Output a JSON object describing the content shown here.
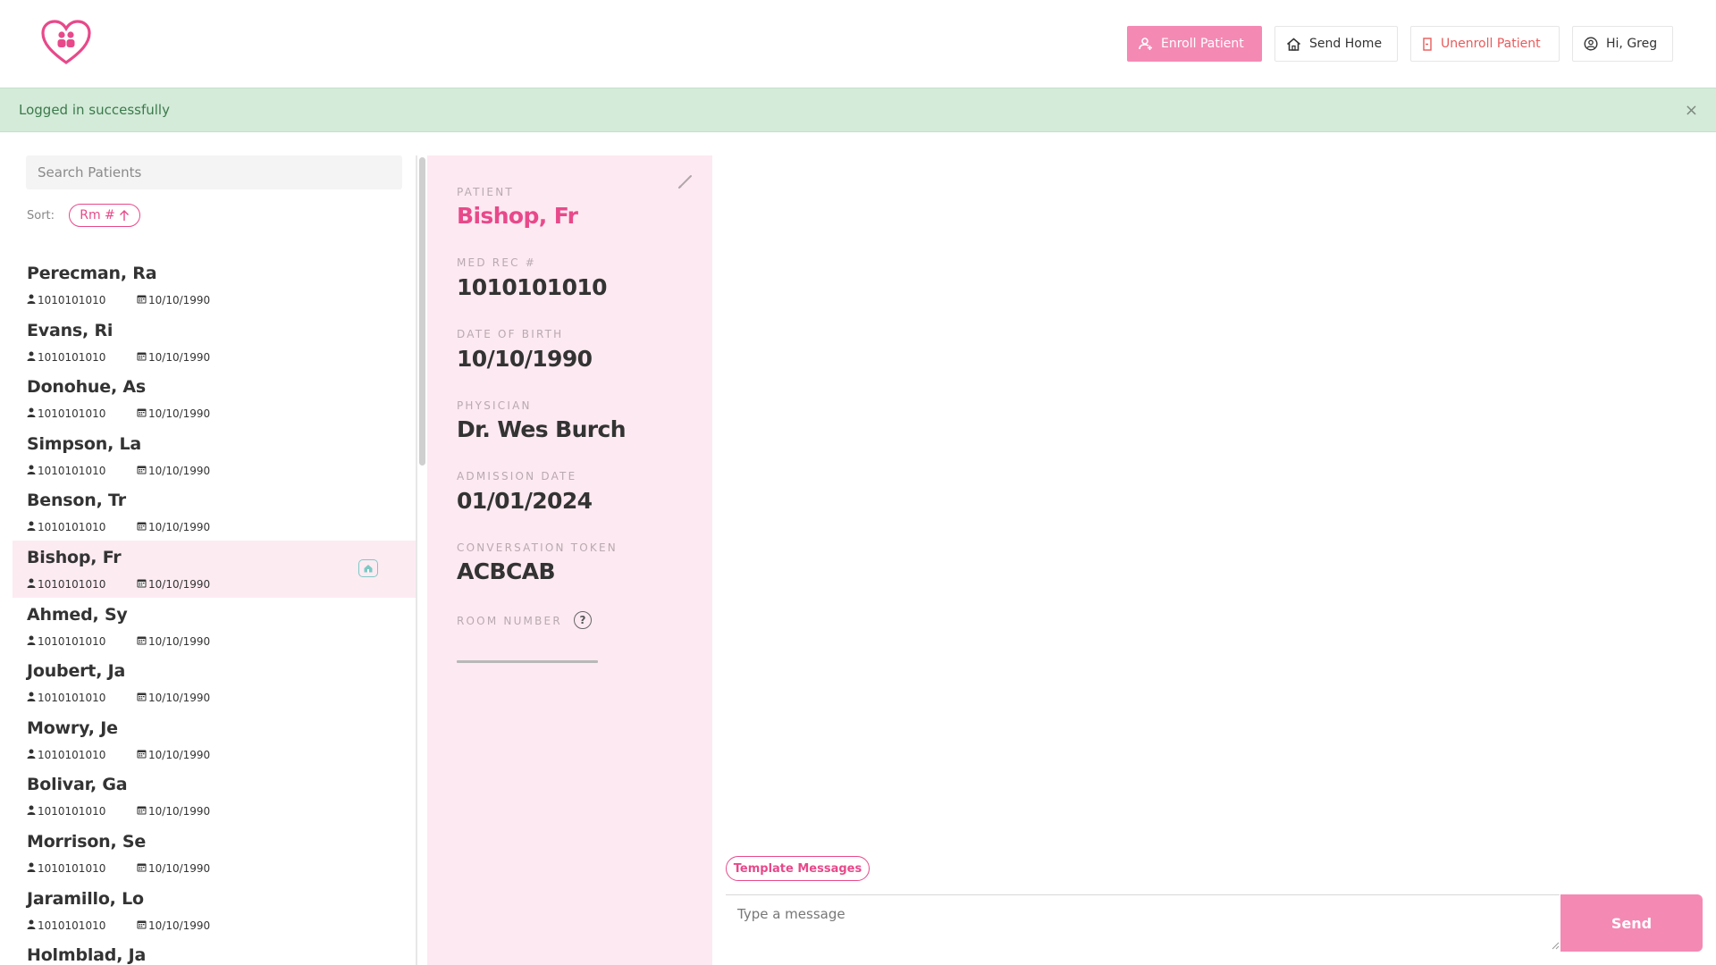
{
  "header": {
    "logo_icon": "heart-people-logo-icon",
    "enroll_label": "Enroll Patient",
    "send_home_label": "Send Home",
    "unenroll_label": "Unenroll Patient",
    "user_label": "Hi, Greg"
  },
  "alert": {
    "message": "Logged in successfully",
    "close": "×"
  },
  "sidebar": {
    "search_placeholder": "Search Patients",
    "sort_label": "Sort:",
    "sort_value": "Rm #",
    "patients": [
      {
        "name": "Perecman, Ra",
        "mrn": "1010101010",
        "dob": "10/10/1990",
        "selected": false
      },
      {
        "name": "Evans, Ri",
        "mrn": "1010101010",
        "dob": "10/10/1990",
        "selected": false
      },
      {
        "name": "Donohue, As",
        "mrn": "1010101010",
        "dob": "10/10/1990",
        "selected": false
      },
      {
        "name": "Simpson, La",
        "mrn": "1010101010",
        "dob": "10/10/1990",
        "selected": false
      },
      {
        "name": "Benson, Tr",
        "mrn": "1010101010",
        "dob": "10/10/1990",
        "selected": false
      },
      {
        "name": "Bishop, Fr",
        "mrn": "1010101010",
        "dob": "10/10/1990",
        "selected": true
      },
      {
        "name": "Ahmed, Sy",
        "mrn": "1010101010",
        "dob": "10/10/1990",
        "selected": false
      },
      {
        "name": "Joubert, Ja",
        "mrn": "1010101010",
        "dob": "10/10/1990",
        "selected": false
      },
      {
        "name": "Mowry, Je",
        "mrn": "1010101010",
        "dob": "10/10/1990",
        "selected": false
      },
      {
        "name": "Bolivar, Ga",
        "mrn": "1010101010",
        "dob": "10/10/1990",
        "selected": false
      },
      {
        "name": "Morrison, Se",
        "mrn": "1010101010",
        "dob": "10/10/1990",
        "selected": false
      },
      {
        "name": "Jaramillo, Lo",
        "mrn": "1010101010",
        "dob": "10/10/1990",
        "selected": false
      },
      {
        "name": "Holmblad, Ja",
        "mrn": "",
        "dob": "",
        "selected": false
      }
    ]
  },
  "detail": {
    "patient_label": "PATIENT",
    "patient_value": "Bishop, Fr",
    "medrec_label": "MED REC #",
    "medrec_value": "1010101010",
    "dob_label": "DATE OF BIRTH",
    "dob_value": "10/10/1990",
    "physician_label": "PHYSICIAN",
    "physician_value": "Dr. Wes Burch",
    "admission_label": "ADMISSION DATE",
    "admission_value": "01/01/2024",
    "token_label": "CONVERSATION TOKEN",
    "token_value": "ACBCAB",
    "room_label": "ROOM NUMBER",
    "room_help": "?"
  },
  "chat": {
    "template_label": "Template Messages",
    "input_placeholder": "Type a message",
    "send_label": "Send"
  },
  "colors": {
    "accent": "#e8498a",
    "accent_light": "#f489b4",
    "panel_bg": "#fde9f1",
    "alert_bg": "#d4ebd9",
    "danger": "#e85a5a",
    "home_badge": "#7cc9c5"
  }
}
